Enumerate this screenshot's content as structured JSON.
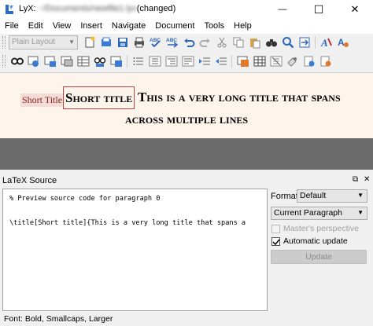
{
  "window": {
    "app": "LyX: ",
    "path": "~/Documents/newfile1.lyx",
    "state": "(changed)",
    "minimize_glyph": "—",
    "maximize_glyph": "☐",
    "close_glyph": "✕"
  },
  "menu": [
    "File",
    "Edit",
    "View",
    "Insert",
    "Navigate",
    "Document",
    "Tools",
    "Help"
  ],
  "toolbar": {
    "layout_combo": "Plain Layout",
    "row1_icons": [
      "new-file-icon",
      "open-file-icon",
      "save-icon",
      "print-icon",
      "spellcheck-icon",
      "thesaurus-icon",
      "undo-icon",
      "redo-icon",
      "cut-icon",
      "copy-icon",
      "paste-icon",
      "find-icon",
      "search-icon",
      "find-replace-icon",
      "font-style-icon",
      "text-style-icon"
    ],
    "row2_icons": [
      "view-output-icon",
      "view-update-icon",
      "compile-icon",
      "view-master-icon",
      "table-icon",
      "view-source-icon",
      "bullet-list-icon",
      "numbered-list-icon",
      "description-list-icon",
      "toc-icon",
      "outdent-icon",
      "indent-icon",
      "insert-graphics-icon",
      "insert-table-icon",
      "math-icon",
      "note-icon",
      "label-icon",
      "cross-ref-icon"
    ]
  },
  "editor": {
    "short_title_label": "Short Title",
    "short_title_text": "Short title",
    "title_line1": "This is a very long title that spans",
    "title_line2": "across multiple lines"
  },
  "dock": {
    "title": "LaTeX Source",
    "float_glyph": "⧉",
    "close_glyph": "✕",
    "source_lines": [
      "% Preview source code for paragraph 0",
      "\\title[Short title]{This is a very long title that spans a"
    ],
    "format_label": "Format:",
    "format_value": "Default",
    "scope_value": "Current Paragraph",
    "masters_perspective": "Master's perspective",
    "automatic_update": "Automatic update",
    "update_button": "Update"
  },
  "status": "Font: Bold, Smallcaps, Larger",
  "colors": {
    "editor_bg": "#fdf4ec",
    "short_title_border": "#c24040",
    "short_title_label_bg": "#f4dcd6",
    "gray_area": "#6b6b6b"
  }
}
